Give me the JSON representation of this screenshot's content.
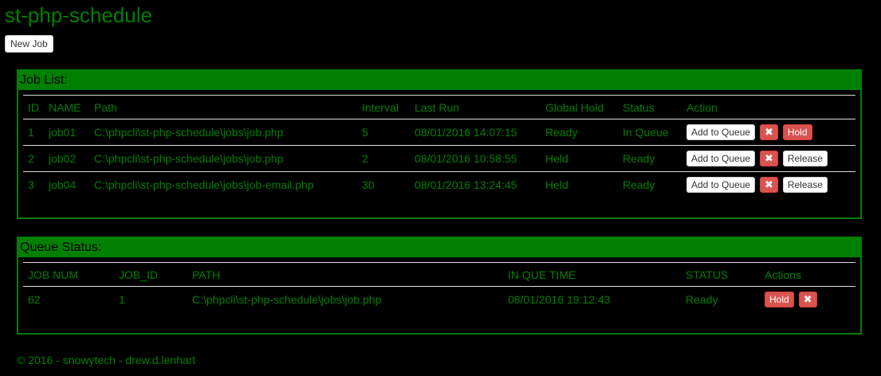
{
  "app": {
    "title": "st-php-schedule",
    "new_job_label": "New Job"
  },
  "job_list": {
    "title": "Job List:",
    "columns": [
      "ID",
      "NAME",
      "Path",
      "Interval",
      "Last Run",
      "Global Hold",
      "Status",
      "Action"
    ],
    "rows": [
      {
        "id": "1",
        "name": "job01",
        "path": "C:\\phpcli\\st-php-schedule\\jobs\\job.php",
        "interval": "5",
        "last_run": "08/01/2016 14:07:15",
        "global_hold": "Ready",
        "status": "In Queue",
        "add_label": "Add to Queue",
        "delete_icon": "✖",
        "toggle_label": "Hold",
        "toggle_style": "danger"
      },
      {
        "id": "2",
        "name": "job02",
        "path": "C:\\phpcli\\st-php-schedule\\jobs\\job.php",
        "interval": "2",
        "last_run": "08/01/2016 10:58:55",
        "global_hold": "Held",
        "status": "Ready",
        "add_label": "Add to Queue",
        "delete_icon": "✖",
        "toggle_label": "Release",
        "toggle_style": "default"
      },
      {
        "id": "3",
        "name": "job04",
        "path": "C:\\phpcli\\st-php-schedule\\jobs\\job-email.php",
        "interval": "30",
        "last_run": "08/01/2016 13:24:45",
        "global_hold": "Held",
        "status": "Ready",
        "add_label": "Add to Queue",
        "delete_icon": "✖",
        "toggle_label": "Release",
        "toggle_style": "default"
      }
    ]
  },
  "queue_status": {
    "title": "Queue Status:",
    "columns": [
      "JOB NUM",
      "JOB_ID",
      "PATH",
      "IN QUE TIME",
      "STATUS",
      "Actions"
    ],
    "rows": [
      {
        "job_num": "62",
        "job_id": "1",
        "path": "C:\\phpcli\\st-php-schedule\\jobs\\job.php",
        "in_que_time": "08/01/2016 19:12:43",
        "status": "Ready",
        "hold_label": "Hold",
        "delete_icon": "✖"
      }
    ]
  },
  "footer": {
    "text": "© 2016 - snowytech - drew.d.lenhart"
  },
  "colors": {
    "accent": "#008000",
    "background": "#000000",
    "danger": "#d9534f"
  },
  "icons": {
    "delete": "delete-x-icon"
  }
}
